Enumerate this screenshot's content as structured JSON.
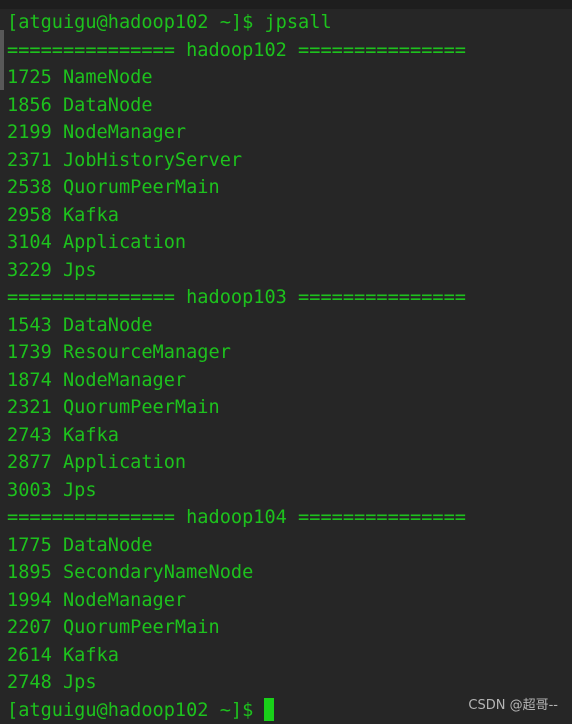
{
  "terminal": {
    "lines": [
      "[atguigu@hadoop102 ~]$ jpsall",
      "=============== hadoop102 ===============",
      "1725 NameNode",
      "1856 DataNode",
      "2199 NodeManager",
      "2371 JobHistoryServer",
      "2538 QuorumPeerMain",
      "2958 Kafka",
      "3104 Application",
      "3229 Jps",
      "=============== hadoop103 ===============",
      "1543 DataNode",
      "1739 ResourceManager",
      "1874 NodeManager",
      "2321 QuorumPeerMain",
      "2743 Kafka",
      "2877 Application",
      "3003 Jps",
      "=============== hadoop104 ===============",
      "1775 DataNode",
      "1895 SecondaryNameNode",
      "1994 NodeManager",
      "2207 QuorumPeerMain",
      "2614 Kafka",
      "2748 Jps"
    ],
    "prompt": "[atguigu@hadoop102 ~]$",
    "text_color": "#1dc21d",
    "background": "#262626"
  },
  "watermark": "CSDN @超哥--"
}
